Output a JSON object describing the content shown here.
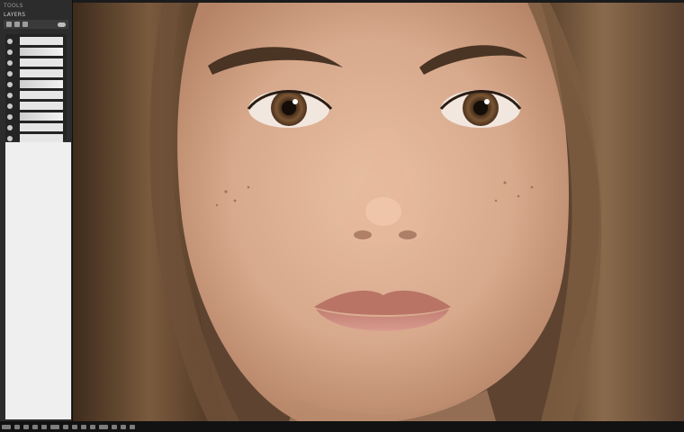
{
  "panel": {
    "title": "TOOLS",
    "subtitle": "LAYERS",
    "toolbar_icons": [
      "layer-icon",
      "mask-icon",
      "link-icon",
      "visibility-icon"
    ],
    "layers": [
      {
        "icon": "visibility-icon"
      },
      {
        "icon": "visibility-icon"
      },
      {
        "icon": "visibility-icon"
      },
      {
        "icon": "visibility-icon"
      },
      {
        "icon": "visibility-icon"
      },
      {
        "icon": "visibility-icon"
      },
      {
        "icon": "visibility-icon"
      },
      {
        "icon": "visibility-icon"
      },
      {
        "icon": "visibility-icon"
      },
      {
        "icon": "visibility-icon"
      }
    ]
  },
  "canvas": {
    "image": "portrait-photo",
    "colors": {
      "background": "#c9c6c2",
      "hair": "#6b4f36",
      "skin": "#d8a98c",
      "lips": "#c98b80",
      "iris": "#6b4a2c"
    }
  },
  "status_bar": {
    "icons": [
      "frame-icon",
      "grid-icon",
      "zoom-icon",
      "hand-icon",
      "crop-icon",
      "brush-icon",
      "eraser-icon",
      "text-icon",
      "shape-icon",
      "pen-icon",
      "fill-icon",
      "picker-icon",
      "layers-icon",
      "history-icon"
    ]
  }
}
